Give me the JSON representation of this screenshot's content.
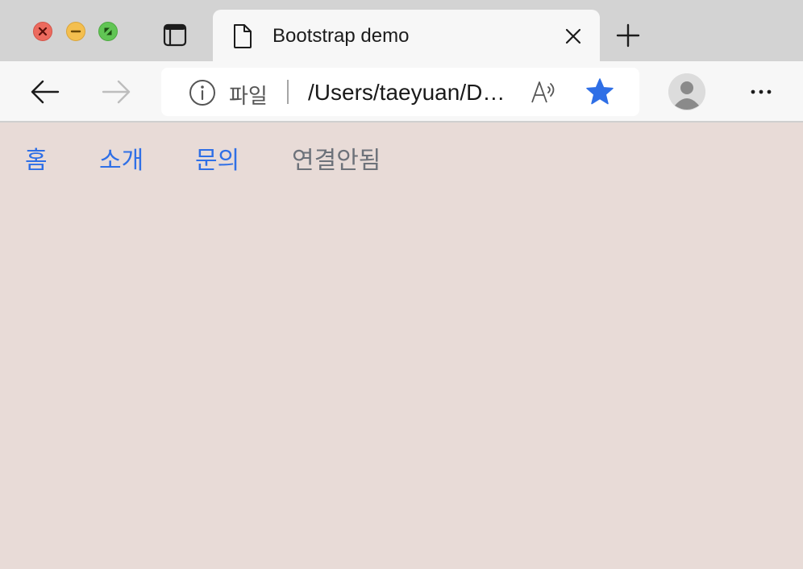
{
  "window": {
    "tab": {
      "title": "Bootstrap demo"
    }
  },
  "toolbar": {
    "address": {
      "scheme_label": "파일",
      "url": "/Users/taeyuan/D…"
    }
  },
  "page": {
    "nav": [
      {
        "label": "홈",
        "state": "link"
      },
      {
        "label": "소개",
        "state": "link"
      },
      {
        "label": "문의",
        "state": "link"
      },
      {
        "label": "연결안됨",
        "state": "disabled"
      }
    ]
  },
  "colors": {
    "page_background": "#e8dbd7",
    "link": "#2f6fe6",
    "disabled_link": "#6d727a",
    "favorite_star": "#2f6fe6"
  },
  "icons": {
    "traffic_lights": [
      "close-icon",
      "minimize-icon",
      "maximize-icon"
    ],
    "tab_actions": "tab-actions-icon",
    "favicon": "document-icon",
    "tab_close": "close-icon",
    "new_tab": "plus-icon",
    "back": "arrow-left-icon",
    "forward": "arrow-right-icon",
    "site_info": "info-icon",
    "read_aloud": "read-aloud-icon",
    "favorite": "star-icon",
    "profile": "avatar-icon",
    "more": "more-icon"
  }
}
